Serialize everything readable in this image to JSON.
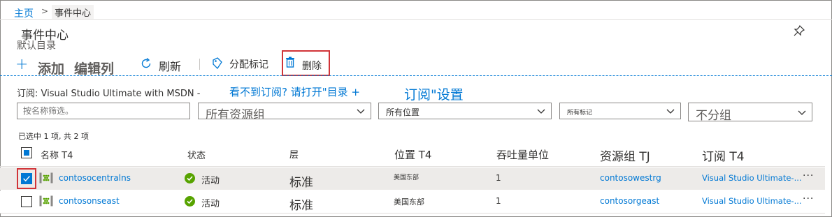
{
  "breadcrumb": {
    "home": "主页",
    "separator": ">",
    "current": "事件中心"
  },
  "header": {
    "title": "事件中心",
    "subtitle": "默认目录"
  },
  "toolbar": {
    "add_icon": "+",
    "add_label": "添加",
    "edit_label": "编辑列",
    "refresh_label": "刷新",
    "tag_label": "分配标记",
    "delete_label": "删除"
  },
  "subscription": {
    "label": "订阅: Visual Studio Ultimate with MSDN -",
    "link1": "看不到订阅? 请打开\"目录 +",
    "link2": "订阅\"设置"
  },
  "filters": {
    "name_placeholder": "按名称筛选。",
    "resource_group": "所有资源组",
    "location": "所有位置",
    "tags": "所有标记",
    "grouping": "不分组"
  },
  "selection_count": "已选中 1 项, 共 2 项",
  "columns": {
    "name": "名称 T4",
    "status": "状态",
    "tier": "层",
    "location": "位置 T4",
    "throughput": "吞吐量单位",
    "resource_group": "资源组 TJ",
    "subscription": "订阅 T4"
  },
  "rows": [
    {
      "name": "contosocentralns",
      "status": "活动",
      "tier": "标准",
      "location": "美国东部",
      "throughput": "1",
      "resource_group": "contosowestrg",
      "subscription": "Visual Studio Ultimate-...",
      "more": "···",
      "selected": true
    },
    {
      "name": "contosonseast",
      "status": "活动",
      "tier": "标准",
      "location": "美国东部",
      "throughput": "1",
      "resource_group": "contosorgeast",
      "subscription": "Visual Studio Ultimate-...",
      "more": "···",
      "selected": false
    }
  ],
  "colors": {
    "accent": "#0078d4",
    "highlight": "#d13438",
    "success": "#57a300"
  }
}
